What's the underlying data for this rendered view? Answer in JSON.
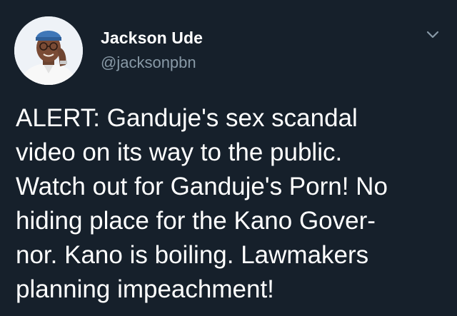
{
  "tweet": {
    "author": {
      "display_name": "Jackson Ude",
      "handle": "@jacksonpbn",
      "avatar_icon": "profile-photo"
    },
    "menu_icon": "chevron-down-icon",
    "text_lines": [
      "ALERT: Ganduje's sex scandal",
      "video on its way to the public.",
      "Watch out for Ganduje's Porn! No",
      "hiding place for the Kano Gover-",
      "nor. Kano is boiling. Lawmakers",
      "planning impeachment!"
    ]
  },
  "colors": {
    "background": "#16202b",
    "primary_text": "#ffffff",
    "secondary_text": "#8899a6"
  }
}
